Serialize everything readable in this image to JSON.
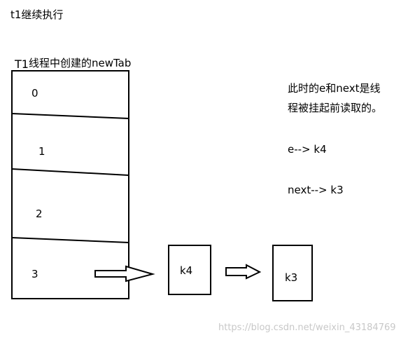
{
  "header": {
    "title": "t1继续执行"
  },
  "table": {
    "label_prefix": "T1",
    "label_rest": "线程中创建的newTab",
    "indices": [
      "0",
      "1",
      "2",
      "3"
    ]
  },
  "nodes": {
    "first": "k4",
    "second": "k3"
  },
  "notes": {
    "line1": "此时的e和next是线",
    "line2": "程被挂起前读取的。",
    "e_ref": "e--> k4",
    "next_ref": "next--> k3"
  },
  "watermark": "https://blog.csdn.net/weixin_43184769",
  "colors": {
    "stroke": "#000000",
    "watermark": "#c8c8c8"
  }
}
